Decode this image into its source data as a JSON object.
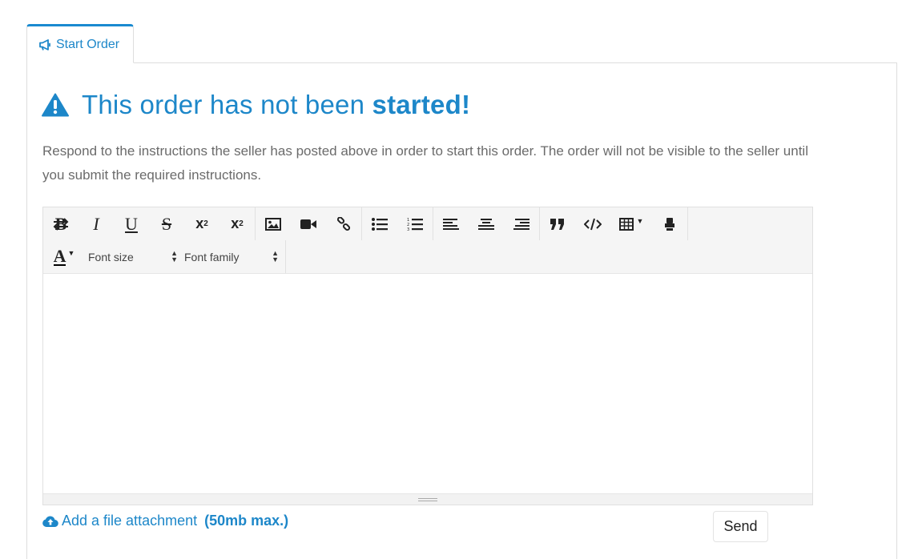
{
  "tabs": [
    {
      "label": "Start Order",
      "icon": "bullhorn-icon",
      "active": true
    }
  ],
  "notice": {
    "title_prefix": "This order has not been ",
    "title_emphasis": "started!",
    "icon": "warning-icon",
    "description": "Respond to the instructions the seller has posted above in order to start this order. The order will not be visible to the seller until you submit the required instructions."
  },
  "editor": {
    "font_size_label": "Font size",
    "font_family_label": "Font family",
    "content": ""
  },
  "footer": {
    "attach_label": "Add a file attachment",
    "attach_limit": "(50mb max.)",
    "send_label": "Send"
  },
  "colors": {
    "accent": "#1d87c9",
    "text": "#6b6b6b",
    "toolbar_bg": "#f5f5f5"
  }
}
